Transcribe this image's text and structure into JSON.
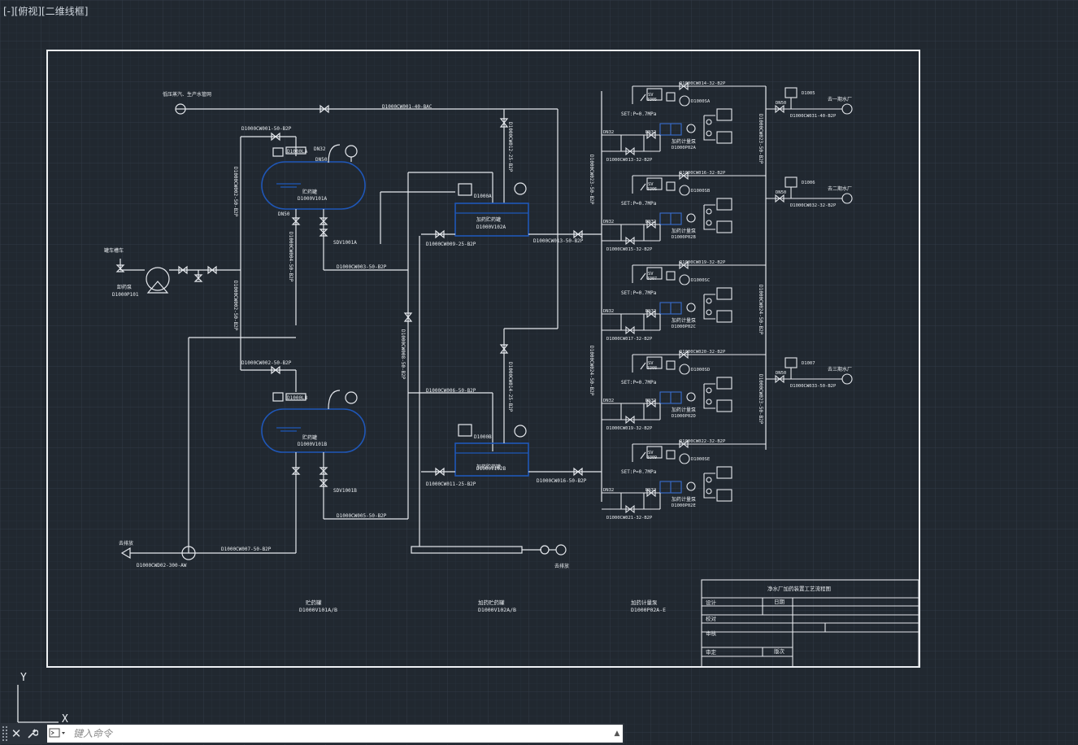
{
  "viewport": {
    "label": "[-][俯视][二维线框]"
  },
  "colors": {
    "background": "#212830",
    "grid": "#2a313b",
    "line": "#e6e9ee",
    "vessel": "#1f57b8",
    "equipment_blue": "#3a6fd0"
  },
  "drawing": {
    "top_inlet_label": "低压蒸汽、生产水管网",
    "top_main_pipe": "D1000CW001-40-BAC",
    "pipe_tank1_top": "D1000CW001-50-B2P",
    "pipe_tank2_top": "D1000CW002-50-B2P",
    "tank1": {
      "name": "贮药罐",
      "tag": "D1000V101A",
      "tag_box": "D1000LA",
      "dn50": "DN50",
      "dn32": "DN32",
      "drain": "DN50"
    },
    "tank2": {
      "name": "贮药罐",
      "tag": "D1000V101B",
      "tag_box": "D1000LB"
    },
    "valve_a": "SDV1001A",
    "valve_b": "SDV1001B",
    "pipe_after_a": "D1000CW003-50-B2P",
    "pipe_after_b": "D1000CW005-50-B2P",
    "truck_label": "罐车槽车",
    "pump_label": "卸药泵",
    "pump_tag": "D1000P101",
    "day_tank1": {
      "name": "加药贮药罐",
      "tag": "D1000V102A",
      "box": "D1000A"
    },
    "day_tank2": {
      "name": "加药贮药罐",
      "tag": "D1000V102B",
      "box": "D1000B"
    },
    "pipe_day1_in": "D1000CW009-25-B2P",
    "pipe_day1_out": "D1000CW013-50-B2P",
    "pipe_day2_top": "D1000CW006-50-B2P",
    "pipe_day2_in": "D1000CW011-25-B2P",
    "pipe_day2_out": "D1000CW016-50-B2P",
    "vertical_pipe_left": "D1000CW002-50-B2P",
    "vertical_pipe_mid": "D1000CW004-50-B2P",
    "vertical_pipe_center": "D1000CW008-50-B2P",
    "vertical_pipe_right": "D1000CW012-25-B2P",
    "vertical_pipe_far": "D1000CW014-25-B2P",
    "bottom_line": "D1000CW007-50-B2P",
    "bottom_exit_label": "去排放",
    "bottom_exit_tag": "D1000CWD02-300-AW",
    "bottom_right_label": "去排放",
    "dosing_units": [
      {
        "sv": "SV",
        "sv_tag": "3305",
        "set": "SET:P=0.7MPa",
        "dn_a": "DN32",
        "dn_b": "DN32",
        "skid": "加药计量泵",
        "skid_tag": "D1000P02A",
        "pipe_top": "D1000CW014-32-B2P",
        "pipe_bottom": "D1000CW013-32-B2P",
        "box": "D1000SA"
      },
      {
        "sv": "SV",
        "sv_tag": "3306",
        "set": "SET:P=0.7MPa",
        "dn_a": "DN32",
        "dn_b": "DN32",
        "skid": "加药计量泵",
        "skid_tag": "D1000P02B",
        "pipe_top": "D1000CW016-32-B2P",
        "pipe_bottom": "D1000CW015-32-B2P",
        "box": "D1000SB"
      },
      {
        "sv": "SV",
        "sv_tag": "3307",
        "set": "SET:P=0.7MPa",
        "dn_a": "DN32",
        "dn_b": "DN32",
        "skid": "加药计量泵",
        "skid_tag": "D1000P02C",
        "pipe_top": "D1000CW019-32-B2P",
        "pipe_bottom": "D1000CW017-32-B2P",
        "box": "D1000SC"
      },
      {
        "sv": "SV",
        "sv_tag": "3308",
        "set": "SET:P=0.7MPa",
        "dn_a": "DN32",
        "dn_b": "DN32",
        "skid": "加药计量泵",
        "skid_tag": "D1000P02D",
        "pipe_top": "D1000CW020-32-B2P",
        "pipe_bottom": "D1000CW019-32-B2P",
        "box": "D1000SD"
      },
      {
        "sv": "SV",
        "sv_tag": "3309",
        "set": "SET:P=0.7MPa",
        "dn_a": "DN32",
        "dn_b": "DN32",
        "skid": "加药计量泵",
        "skid_tag": "D1000P02E",
        "pipe_top": "D1000CW022-32-B2P",
        "pipe_bottom": "D1000CW021-32-B2P",
        "box": "D1000SE"
      }
    ],
    "header_pipe_right": "D1000CW023-50-B2P",
    "header_pipe_right2": "D1000CW024-50-B2P",
    "outlets": [
      {
        "tag": "D1005",
        "dn": "DN50",
        "pipe": "D1000CW031-40-B2P",
        "dest": "去一期水厂"
      },
      {
        "tag": "D1006",
        "dn": "DN50",
        "pipe": "D1000CW032-32-B2P",
        "dest": "去二期水厂"
      },
      {
        "tag": "D1007",
        "dn": "DN50",
        "pipe": "D1000CW033-50-B2P",
        "dest": "去三期水厂"
      }
    ],
    "legend": [
      {
        "name": "贮药罐",
        "tag": "D1000V101A/B"
      },
      {
        "name": "加药贮药罐",
        "tag": "D1000V102A/B"
      },
      {
        "name": "加药计量泵",
        "tag": "D1000P02A-E"
      }
    ],
    "title_block": {
      "title": "净水厂加药装置工艺流程图",
      "design": "设计",
      "date": "日期",
      "check": "校对",
      "review": "审核",
      "approve": "审定",
      "version": "版次"
    }
  },
  "ucs": {
    "y": "Y",
    "x": "X"
  },
  "command": {
    "placeholder": "键入命令"
  }
}
